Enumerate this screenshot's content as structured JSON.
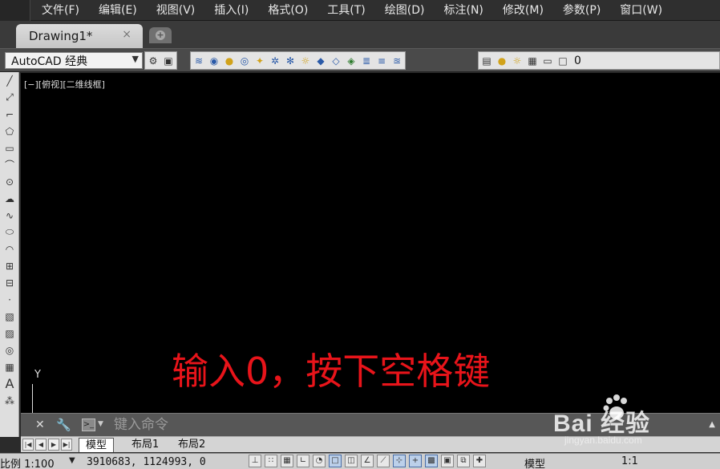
{
  "menu": [
    "文件(F)",
    "编辑(E)",
    "视图(V)",
    "插入(I)",
    "格式(O)",
    "工具(T)",
    "绘图(D)",
    "标注(N)",
    "修改(M)",
    "参数(P)",
    "窗口(W)"
  ],
  "tabs": {
    "active_label": "Drawing1*",
    "close_glyph": "×",
    "new_tab_glyph": "+"
  },
  "toolbar": {
    "workspace_value": "AutoCAD 经典",
    "layer_value": "0"
  },
  "viewport": {
    "view_label": "[−][俯视][二维线框]",
    "ucs_axis": "Y"
  },
  "overlay": {
    "instruction": "输入0，按下空格键"
  },
  "command_line": {
    "placeholder": "键入命令"
  },
  "layout_tabs": [
    "模型",
    "布局1",
    "布局2"
  ],
  "status_bar": {
    "scale_label": "比例 1:100",
    "coordinates": "3910683, 1124993, 0",
    "model_label": "模型",
    "annotation_scale": "1:1"
  },
  "watermark": {
    "brand": "Bai  经验",
    "url": "jingyan.baidu.com"
  },
  "colors": {
    "canvas": "#000000",
    "overlay_text": "#e8141a",
    "menubar": "#2f2f2f"
  }
}
